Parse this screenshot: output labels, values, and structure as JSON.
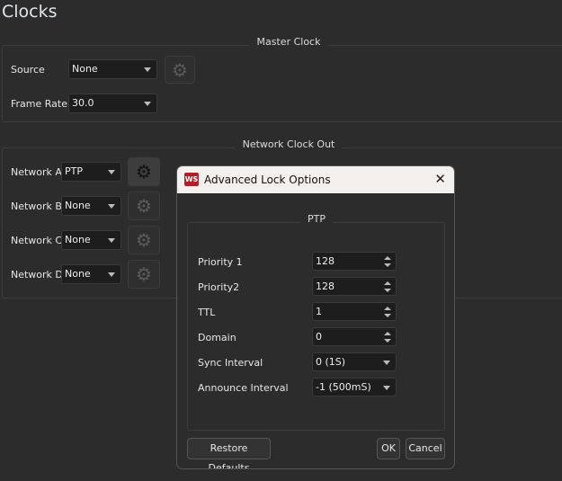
{
  "page_title": "Clocks",
  "master_clock": {
    "title": "Master Clock",
    "source_label": "Source",
    "source_value": "None",
    "frame_rate_label": "Frame Rate",
    "frame_rate_value": "30.0"
  },
  "network_clock_out": {
    "title": "Network Clock Out",
    "rows": [
      {
        "label": "Network A",
        "value": "PTP"
      },
      {
        "label": "Network B",
        "value": "None"
      },
      {
        "label": "Network C",
        "value": "None"
      },
      {
        "label": "Network D",
        "value": "None"
      }
    ]
  },
  "dialog": {
    "title": "Advanced Lock Options",
    "logo_text": "WS",
    "group_title": "PTP",
    "fields": [
      {
        "label": "Priority 1",
        "value": "128",
        "type": "spin"
      },
      {
        "label": "Priority2",
        "value": "128",
        "type": "spin"
      },
      {
        "label": "TTL",
        "value": "1",
        "type": "spin"
      },
      {
        "label": "Domain",
        "value": "0",
        "type": "spin"
      },
      {
        "label": "Sync Interval",
        "value": "0 (1S)",
        "type": "combo"
      },
      {
        "label": "Announce Interval",
        "value": "-1 (500mS)",
        "type": "combo"
      }
    ],
    "restore_label": "Restore Defaults",
    "ok_label": "OK",
    "cancel_label": "Cancel",
    "close_glyph": "✕"
  },
  "icons": {
    "gear": "⚙"
  }
}
